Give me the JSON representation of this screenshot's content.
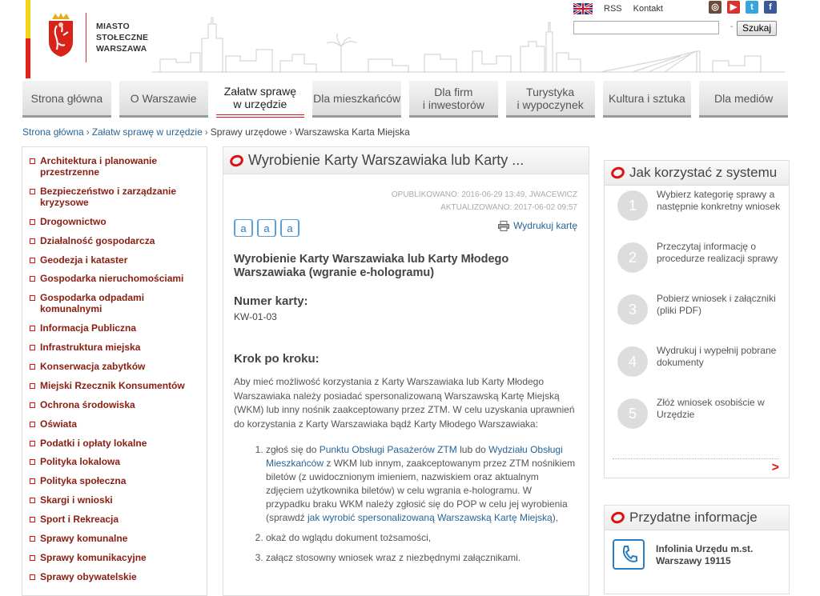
{
  "logo": {
    "line1": "MIASTO",
    "line2": "STOŁECZNE",
    "line3": "WARSZAWA"
  },
  "top_links": {
    "rss": "RSS",
    "contact": "Kontakt"
  },
  "social": {
    "instagram": "instagram-icon",
    "youtube": "youtube-icon",
    "twitter": "twitter-icon",
    "facebook": "facebook-icon"
  },
  "search": {
    "placeholder": "",
    "dash": "-",
    "button": "Szukaj"
  },
  "nav": [
    {
      "label": "Strona główna"
    },
    {
      "label": "O Warszawie"
    },
    {
      "label": "Załatw sprawę\nw urzędzie",
      "active": true
    },
    {
      "label": "Dla mieszkańców"
    },
    {
      "label": "Dla firm\ni inwestorów"
    },
    {
      "label": "Turystyka\ni wypoczynek"
    },
    {
      "label": "Kultura i sztuka"
    },
    {
      "label": "Dla mediów"
    }
  ],
  "breadcrumb": {
    "home": "Strona główna",
    "section": "Załatw sprawę w urzędzie",
    "sub": "Sprawy urzędowe",
    "current": "Warszawska Karta Miejska"
  },
  "sidebar": [
    "Architektura i planowanie przestrzenne",
    "Bezpieczeństwo i zarządzanie kryzysowe",
    "Drogownictwo",
    "Działalność gospodarcza",
    "Geodezja i kataster",
    "Gospodarka nieruchomościami",
    "Gospodarka odpadami komunalnymi",
    "Informacja Publiczna",
    "Infrastruktura miejska",
    "Konserwacja zabytków",
    "Miejski Rzecznik Konsumentów",
    "Ochrona środowiska",
    "Oświata",
    "Podatki i opłaty lokalne",
    "Polityka lokalowa",
    "Polityka społeczna",
    "Skargi i wnioski",
    "Sport i Rekreacja",
    "Sprawy komunalne",
    "Sprawy komunikacyjne",
    "Sprawy obywatelskie"
  ],
  "main": {
    "header": "Wyrobienie Karty Warszawiaka lub Karty ...",
    "published": "OPUBLIKOWANO: 2016-06-29 13:49, JWACEWICZ",
    "updated": "AKTUALIZOWANO: 2017-06-02 09:57",
    "font_a_large": "a",
    "font_a_medium": "a",
    "font_a_small": "a",
    "print_label": "Wydrukuj kartę",
    "title": "Wyrobienie Karty Warszawiaka lub Karty Młodego Warszawiaka (wgranie e-hologramu)",
    "number_heading": "Numer karty:",
    "number_value": "KW-01-03",
    "steps_heading": "Krok po kroku:",
    "intro": "Aby mieć możliwość korzystania z Karty Warszawiaka lub Karty Młodego Warszawiaka należy posiadać spersonalizowaną Warszawską Kartę Miejską (WKM) lub inny nośnik zaakceptowany przez ZTM. W celu uzyskania uprawnień do korzystania z Karty Warszawiaka bądź Karty Młodego Warszawiaka:",
    "step1_a": "zgłoś się do ",
    "step1_link1": "Punktu Obsługi Pasażerów ZTM",
    "step1_b": " lub do ",
    "step1_link2": "Wydziału Obsługi Mieszkańców",
    "step1_c": " z WKM lub innym, zaakceptowanym przez ZTM nośnikiem biletów (z uwidocznionym imieniem, nazwiskiem oraz aktualnym zdjęciem użytkownika biletów) w celu wgrania e-hologramu. W przypadku braku WKM należy zgłosić się do POP w celu jej wyrobienia (sprawdź ",
    "step1_link3": "jak wyrobić spersonalizowaną Warszawską Kartę Miejską",
    "step1_d": "),",
    "step2": "okaż do wglądu dokument tożsamości,",
    "step3": "załącz stosowny wniosek wraz z niezbędnymi załącznikami."
  },
  "how": {
    "title": "Jak korzystać z systemu",
    "steps": [
      {
        "num": "1",
        "text": "Wybierz kategorię sprawy a następnie konkretny wniosek"
      },
      {
        "num": "2",
        "text": "Przeczytaj informację o procedurze realizacji sprawy"
      },
      {
        "num": "3",
        "text": "Pobierz wniosek i załączniki (pliki PDF)"
      },
      {
        "num": "4",
        "text": "Wydrukuj i wypełnij pobrane dokumenty"
      },
      {
        "num": "5",
        "text": "Złóż wniosek osobiście w Urzędzie"
      }
    ],
    "more": ">"
  },
  "useful": {
    "title": "Przydatne informacje",
    "line1": "Infolinia Urzędu m.st.",
    "line2": "Warszawy 19115"
  },
  "colors": {
    "accent": "#d11111",
    "link": "#2a6496",
    "sidebar_text": "#8a1d12"
  }
}
